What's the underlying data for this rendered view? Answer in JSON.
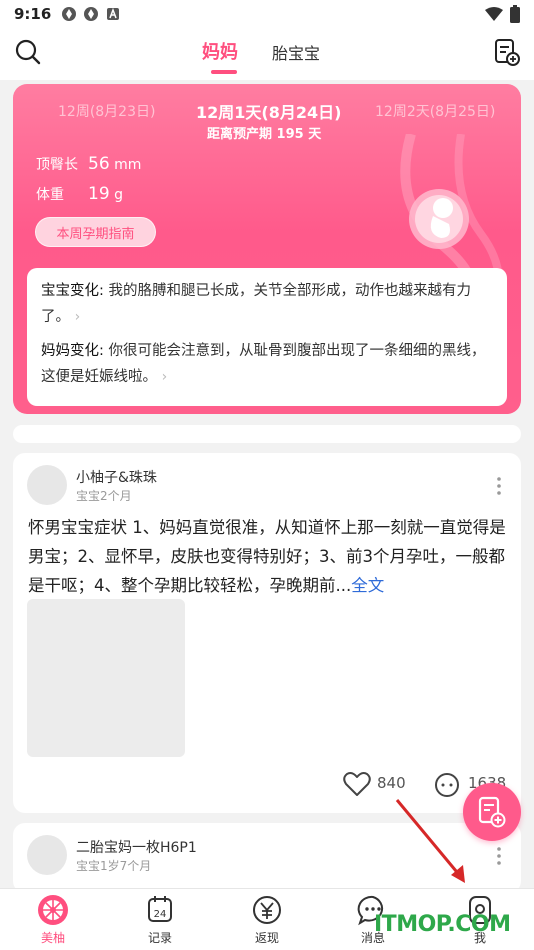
{
  "status_bar": {
    "time": "9:16"
  },
  "top_nav": {
    "tab_mama": "妈妈",
    "tab_baby": "胎宝宝"
  },
  "pregnancy": {
    "prev_day": "12周(8月23日)",
    "current_day": "12周1天(8月24日)",
    "next_day": "12周2天(8月25日)",
    "due_prefix": "距离预产期",
    "due_days": "195",
    "due_suffix": "天",
    "length_label": "顶臀长",
    "length_value": "56",
    "length_unit": "mm",
    "weight_label": "体重",
    "weight_value": "19",
    "weight_unit": "g",
    "guide_button": "本周孕期指南",
    "baby_change_label": "宝宝变化:",
    "baby_change_text": "我的胳膊和腿已长成，关节全部形成，动作也越来越有力了。",
    "mom_change_label": "妈妈变化:",
    "mom_change_text": "你很可能会注意到，从耻骨到腹部出现了一条细细的黑线，这便是妊娠线啦。"
  },
  "posts": [
    {
      "username": "小柚子&珠珠",
      "baby_age": "宝宝2个月",
      "text": "怀男宝宝症状 1、妈妈直觉很准，从知道怀上那一刻就一直觉得是男宝；2、显怀早，皮肤也变得特别好；3、前3个月孕吐，一般都是干呕；4、整个孕期比较轻松，孕晚期前...",
      "more_link": "全文",
      "likes": "840",
      "comments": "1638"
    },
    {
      "username": "二胎宝妈一枚H6P1",
      "baby_age": "宝宝1岁7个月"
    }
  ],
  "bottom_nav": [
    {
      "label": "美柚",
      "icon": "meiyou-logo-icon"
    },
    {
      "label": "记录",
      "icon": "calendar-icon",
      "day": "24"
    },
    {
      "label": "返现",
      "icon": "yen-icon"
    },
    {
      "label": "消息",
      "icon": "message-icon"
    },
    {
      "label": "我",
      "icon": "profile-icon"
    }
  ],
  "watermark": "ITMOP.COM",
  "colors": {
    "accent": "#ff4f7f",
    "card_pink": "#ff5a8b",
    "link_blue": "#2f6bd8",
    "arrow_red": "#d62828"
  }
}
